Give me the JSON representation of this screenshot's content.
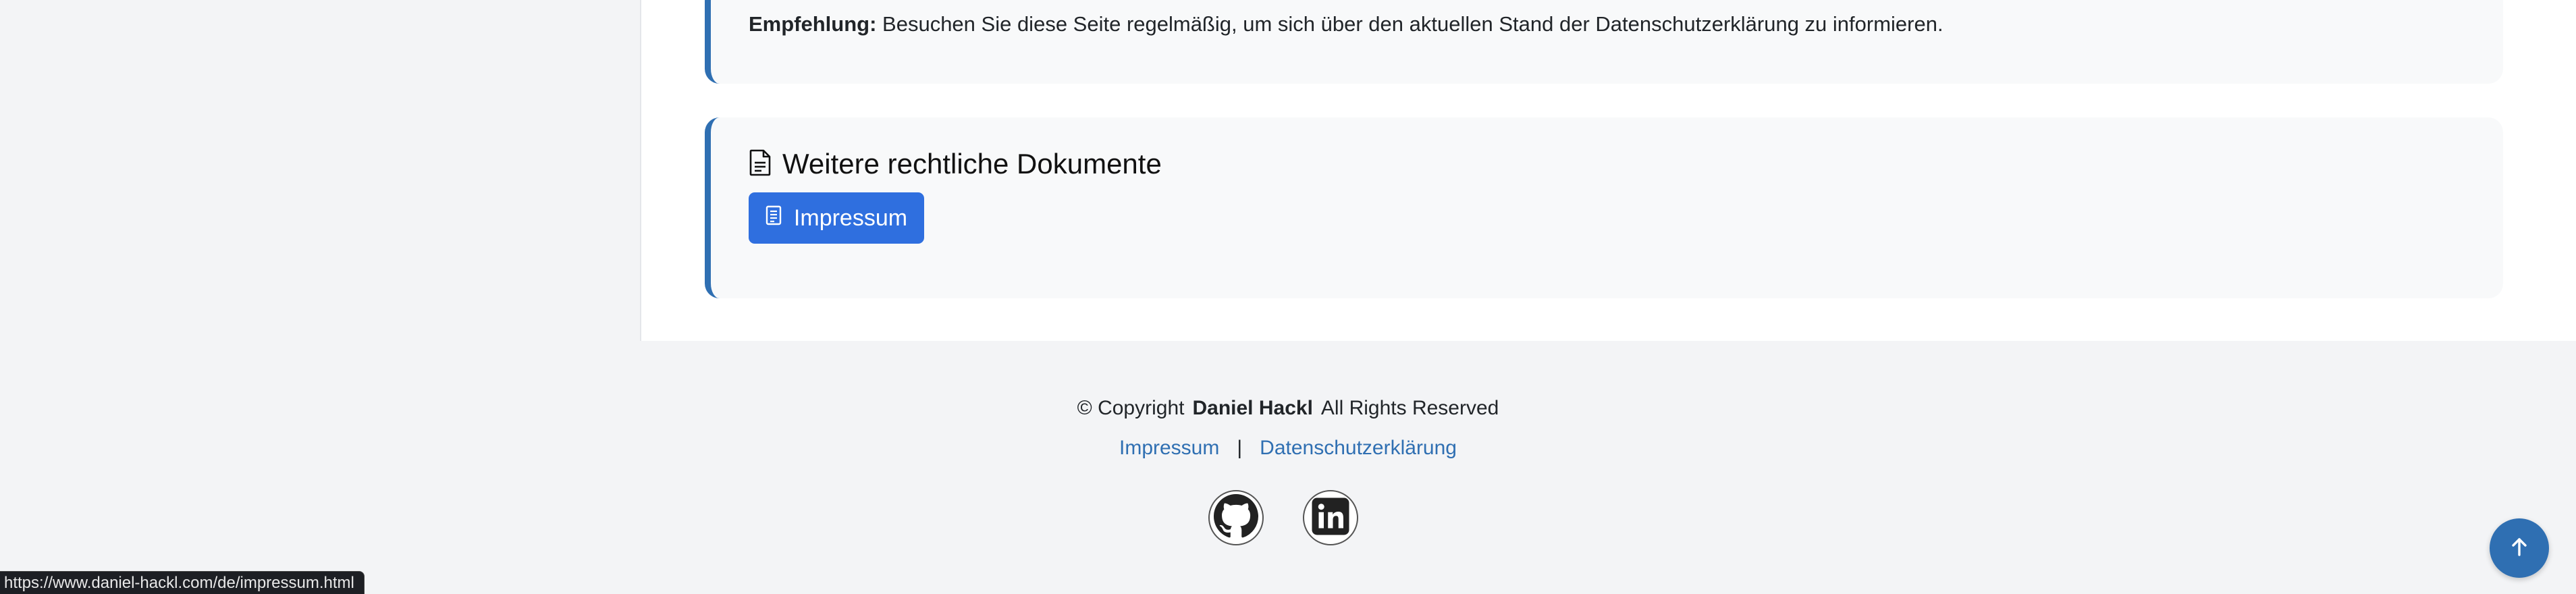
{
  "recommendation": {
    "label": "Empfehlung:",
    "text": " Besuchen Sie diese Seite regelmäßig, um sich über den aktuellen Stand der Datenschutzerklärung zu informieren."
  },
  "documents": {
    "title": "Weitere rechtliche Dokumente",
    "impressum_button": "Impressum",
    "title_icon": "document-icon",
    "button_icon": "document-text-icon"
  },
  "footer": {
    "copyright_prefix": "© Copyright",
    "owner": "Daniel Hackl",
    "rights": "All Rights Reserved",
    "link_impressum": "Impressum",
    "separator": "|",
    "link_datenschutz": "Datenschutzerklärung",
    "social": [
      "github-icon",
      "linkedin-icon"
    ]
  },
  "back_to_top_icon": "arrow-up-icon",
  "status_bar": {
    "url": "https://www.daniel-hackl.com/de/impressum.html"
  },
  "colors": {
    "accent": "#2f6fb2",
    "button": "#2f6fdf",
    "card_bg": "#f8f9fa",
    "page_bg": "#f3f4f6"
  }
}
